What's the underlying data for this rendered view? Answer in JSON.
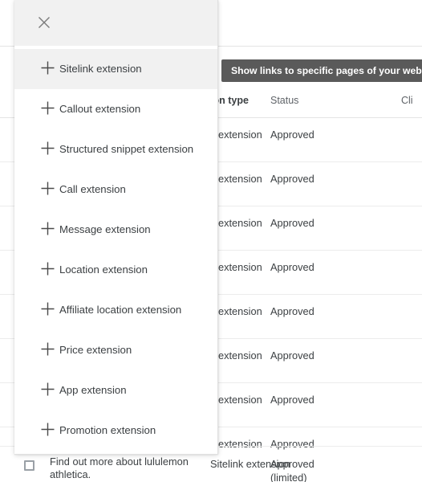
{
  "panel": {
    "close_icon": "close-icon",
    "items": [
      {
        "icon": "plus-icon",
        "label": "Sitelink extension",
        "highlighted": true
      },
      {
        "icon": "plus-icon",
        "label": "Callout extension",
        "highlighted": false
      },
      {
        "icon": "plus-icon",
        "label": "Structured snippet extension",
        "highlighted": false
      },
      {
        "icon": "plus-icon",
        "label": "Call extension",
        "highlighted": false
      },
      {
        "icon": "plus-icon",
        "label": "Message extension",
        "highlighted": false
      },
      {
        "icon": "plus-icon",
        "label": "Location extension",
        "highlighted": false
      },
      {
        "icon": "plus-icon",
        "label": "Affiliate location extension",
        "highlighted": false
      },
      {
        "icon": "plus-icon",
        "label": "Price extension",
        "highlighted": false
      },
      {
        "icon": "plus-icon",
        "label": "App extension",
        "highlighted": false
      },
      {
        "icon": "plus-icon",
        "label": "Promotion extension",
        "highlighted": false
      }
    ]
  },
  "tooltip": {
    "text": "Show links to specific pages of your website"
  },
  "table": {
    "headers": {
      "type": "ion type",
      "status": "Status",
      "clicks": "Cli"
    },
    "rows": [
      {
        "type": "k extension",
        "status": "Approved"
      },
      {
        "type": "k extension",
        "status": "Approved"
      },
      {
        "type": "k extension",
        "status": "Approved"
      },
      {
        "type": "k extension",
        "status": "Approved"
      },
      {
        "type": "k extension",
        "status": "Approved"
      },
      {
        "type": "k extension",
        "status": "Approved"
      },
      {
        "type": "k extension",
        "status": "Approved"
      },
      {
        "type": "k extension",
        "status": "Approved"
      }
    ],
    "last_row": {
      "name": "Find out more about lululemon athletica.",
      "type": "Sitelink extension",
      "status": "Approved (limited)"
    }
  },
  "colors": {
    "panel_header_bg": "#f1f1f1",
    "highlight_bg": "#f1f1f1",
    "tooltip_bg": "#5a5a5a",
    "text": "#3c4043",
    "muted_text": "#5f6368",
    "divider": "#ececec"
  }
}
